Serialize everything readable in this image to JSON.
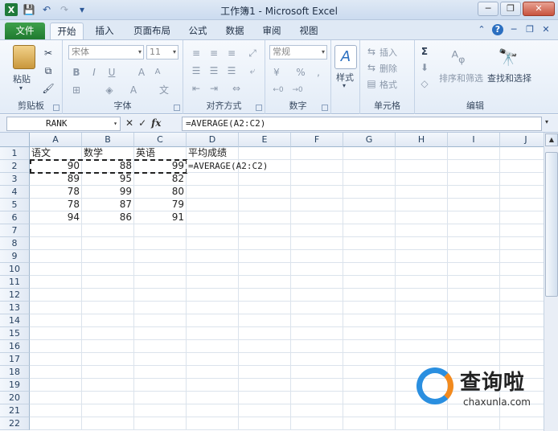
{
  "window": {
    "title": "工作簿1 - Microsoft Excel",
    "controls": [
      "─",
      "❐",
      "✕"
    ]
  },
  "qat": {
    "icons": [
      "excel-logo",
      "save-icon",
      "undo-icon",
      "redo-icon",
      "customize-icon"
    ],
    "excel_logo": "X",
    "save": "💾",
    "undo": "↶",
    "redo": "↷",
    "customize": "▾"
  },
  "tabs": [
    {
      "label": "文件",
      "active": false
    },
    {
      "label": "开始",
      "active": true
    },
    {
      "label": "插入",
      "active": false
    },
    {
      "label": "页面布局",
      "active": false
    },
    {
      "label": "公式",
      "active": false
    },
    {
      "label": "数据",
      "active": false
    },
    {
      "label": "审阅",
      "active": false
    },
    {
      "label": "视图",
      "active": false
    }
  ],
  "ribbon": {
    "clipboard": {
      "paste": "粘贴",
      "label": "剪贴板"
    },
    "font": {
      "name": "宋体",
      "size": "11",
      "bold": "B",
      "italic": "I",
      "underline": "U",
      "grow": "A",
      "shrink": "A",
      "label": "字体"
    },
    "align": {
      "label": "对齐方式"
    },
    "number": {
      "format": "常规",
      "percent": "%",
      "comma": ",",
      "label": "数字"
    },
    "styles": {
      "label": "样式"
    },
    "cells": {
      "insert": "插入",
      "delete": "删除",
      "format": "格式",
      "label": "单元格"
    },
    "editing": {
      "sum": "Σ",
      "sort": "排序和筛选",
      "find": "查找和选择",
      "label": "编辑"
    }
  },
  "formula_bar": {
    "name_box": "RANK",
    "cancel": "✕",
    "enter": "✓",
    "fx": "fx",
    "formula": "=AVERAGE(A2:C2)"
  },
  "sheet": {
    "columns": [
      "A",
      "B",
      "C",
      "D",
      "E",
      "F",
      "G",
      "H",
      "I",
      "J"
    ],
    "rows": [
      "1",
      "2",
      "3",
      "4",
      "5",
      "6",
      "7",
      "8",
      "9",
      "10",
      "11",
      "12",
      "13",
      "14",
      "15",
      "16",
      "17",
      "18",
      "19",
      "20",
      "21",
      "22"
    ],
    "headers": [
      "语文",
      "数学",
      "英语",
      "平均成绩"
    ],
    "data": [
      [
        90,
        88,
        99
      ],
      [
        89,
        95,
        82
      ],
      [
        78,
        99,
        80
      ],
      [
        78,
        87,
        79
      ],
      [
        94,
        86,
        91
      ]
    ],
    "d2_formula": "=AVERAGE(A2:C2)"
  },
  "watermark": {
    "title": "查询啦",
    "url": "chaxunla.com"
  }
}
